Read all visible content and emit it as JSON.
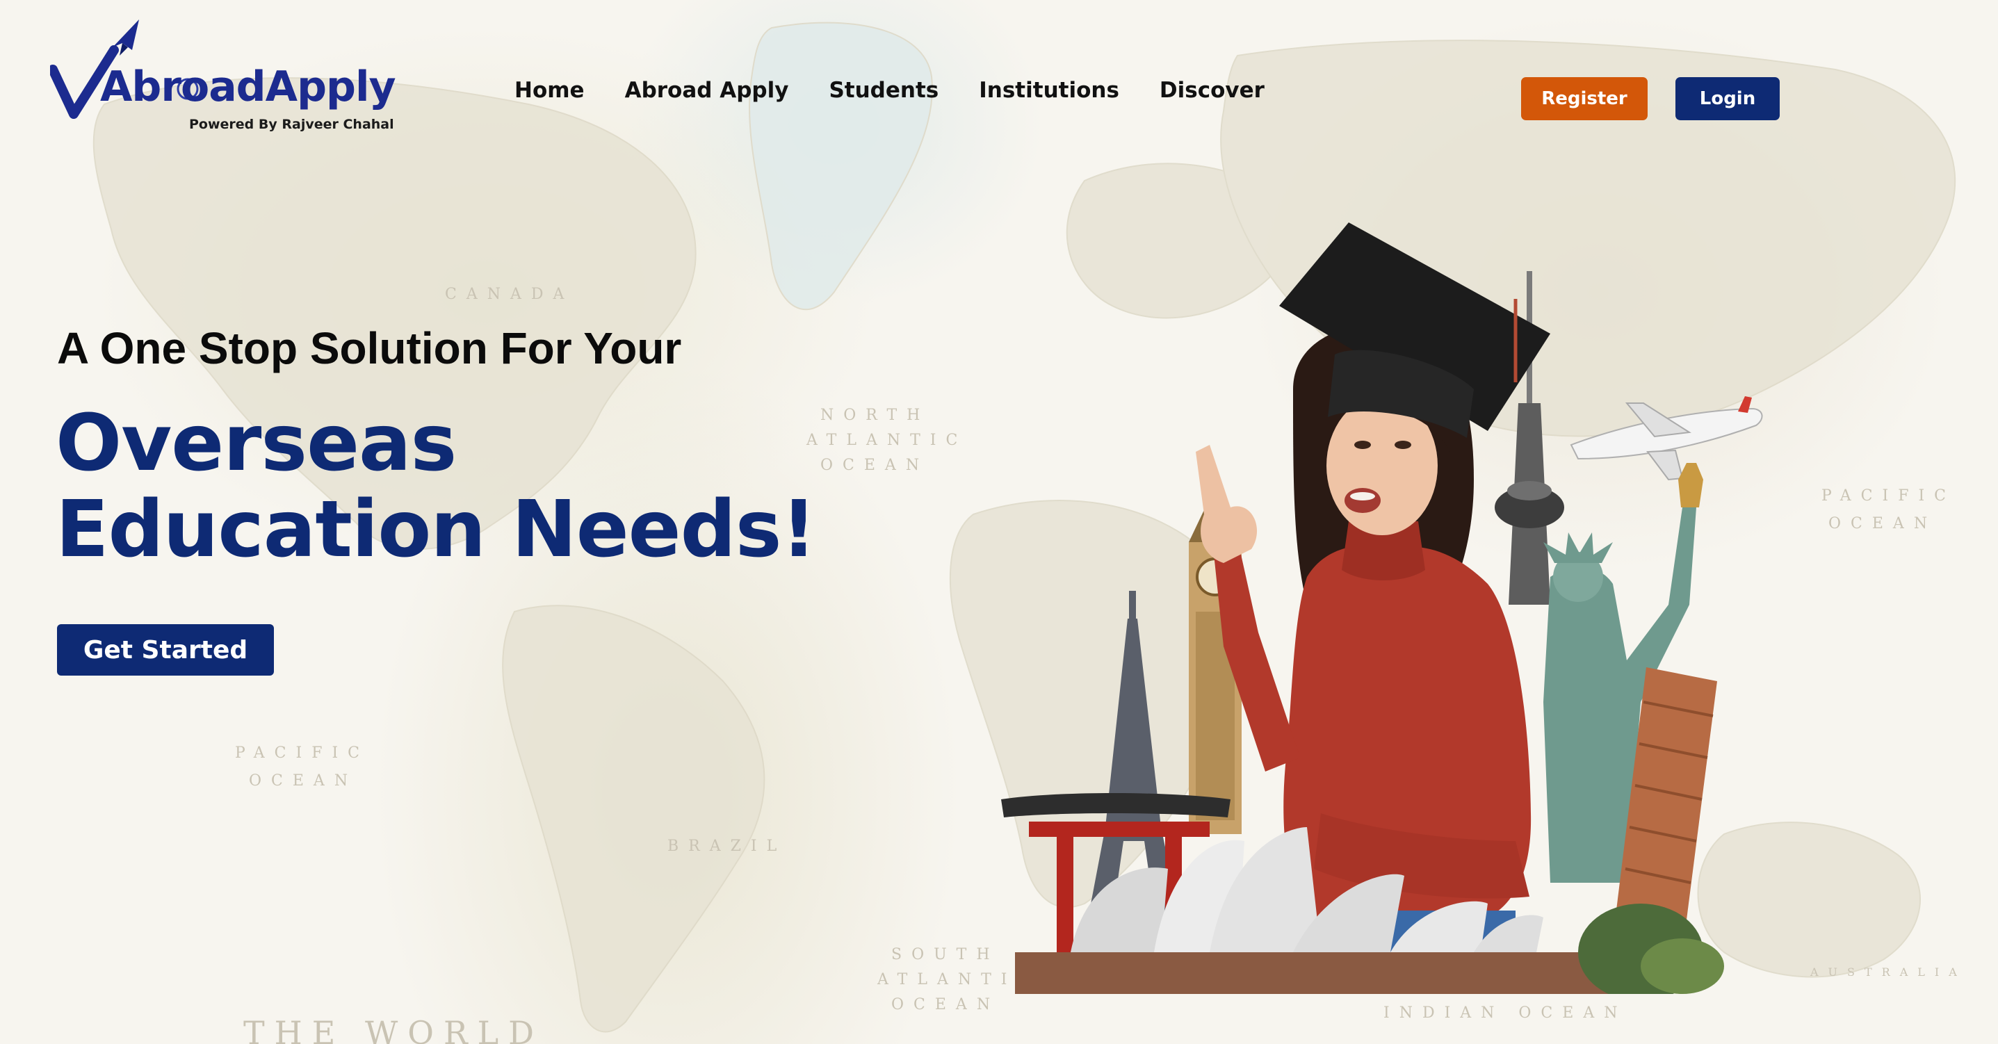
{
  "header": {
    "logo": {
      "brand": "AbroadApply",
      "tagline": "Powered By Rajveer Chahal"
    },
    "nav": [
      {
        "label": "Home"
      },
      {
        "label": "Abroad Apply"
      },
      {
        "label": "Students"
      },
      {
        "label": "Institutions"
      },
      {
        "label": "Discover"
      }
    ],
    "register_label": "Register",
    "login_label": "Login"
  },
  "hero": {
    "subtitle": "A One Stop Solution For Your",
    "title_line1": "Overseas",
    "title_line2": "Education Needs!",
    "cta_label": "Get Started"
  },
  "map_labels": {
    "canada": "CANADA",
    "north_atlantic": "NORTH",
    "atlantic": "ATLANTIC",
    "ocean1": "OCEAN",
    "pacific_left": "PACIFIC",
    "ocean2": "OCEAN",
    "brazil": "BRAZIL",
    "south": "SOUTH",
    "south_atlantic": "ATLANTIC",
    "ocean3": "OCEAN",
    "pacific_right": "PACIFIC",
    "ocean4": "OCEAN",
    "indian_ocean": "INDIAN OCEAN",
    "australia": "AUSTRALIA",
    "the_world": "THE WORLD"
  },
  "colors": {
    "primary_navy": "#0e2a74",
    "accent_orange": "#d35709",
    "logo_blue": "#1c2b8f"
  }
}
